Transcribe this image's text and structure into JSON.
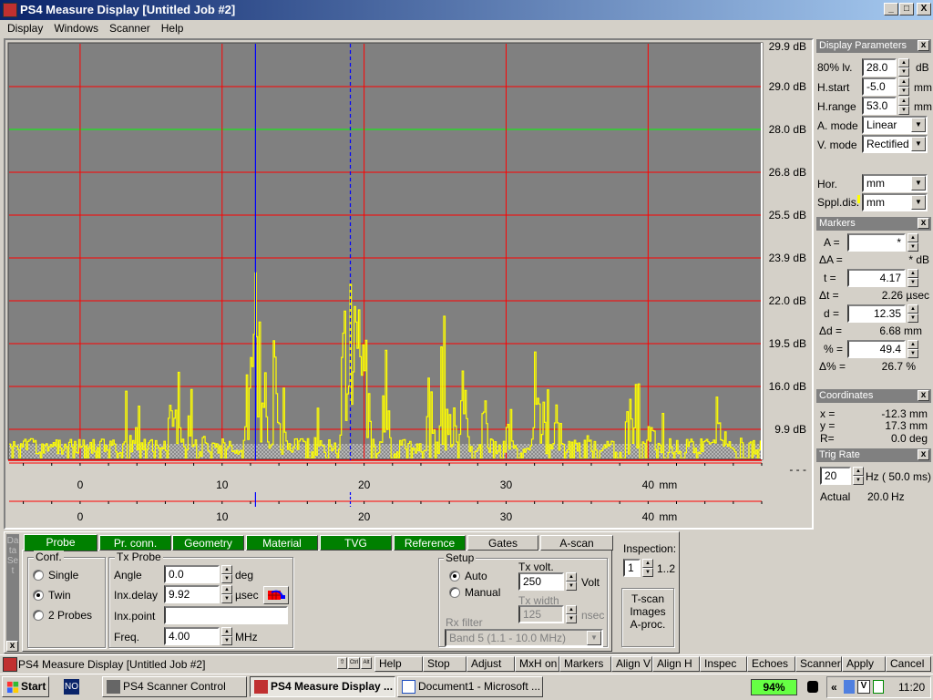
{
  "window": {
    "title": "PS4 Measure Display [Untitled Job #2]",
    "controls": [
      "_",
      "□",
      "X"
    ]
  },
  "menu": [
    "Display",
    "Windows",
    "Scanner",
    "Help"
  ],
  "chart_data": {
    "type": "line",
    "series_color": "#ffff00",
    "background": "#808080",
    "grid": true,
    "grid_color": "#ff0000",
    "ref_line": {
      "level_pct": 80,
      "color": "#00ff00"
    },
    "x_unit": "mm",
    "xlim": [
      -5,
      48
    ],
    "x_ticks": [
      0,
      10,
      20,
      30,
      40
    ],
    "ylim_pct": [
      0,
      100
    ],
    "y_tick_labels": [
      "29.9 dB",
      "29.0 dB",
      "28.0 dB",
      "26.8 dB",
      "25.5 dB",
      "23.9 dB",
      "22.0 dB",
      "19.5 dB",
      "16.0 dB",
      "9.9 dB",
      "- - -"
    ],
    "markers": {
      "solid_mm": 12.35,
      "dashed_mm": 19.03,
      "color": "#0000ff"
    },
    "noise_level_pct": 6,
    "peaks": [
      {
        "x": 3.3,
        "amp": 24
      },
      {
        "x": 4.0,
        "amp": 18
      },
      {
        "x": 6.3,
        "amp": 30
      },
      {
        "x": 6.8,
        "amp": 30
      },
      {
        "x": 7.8,
        "amp": 25
      },
      {
        "x": 8.5,
        "amp": 25
      },
      {
        "x": 11.9,
        "amp": 42
      },
      {
        "x": 12.4,
        "amp": 81
      },
      {
        "x": 12.8,
        "amp": 65
      },
      {
        "x": 13.6,
        "amp": 42
      },
      {
        "x": 14.2,
        "amp": 24
      },
      {
        "x": 16.0,
        "amp": 18
      },
      {
        "x": 16.6,
        "amp": 18
      },
      {
        "x": 18.6,
        "amp": 58
      },
      {
        "x": 19.2,
        "amp": 81
      },
      {
        "x": 19.7,
        "amp": 65
      },
      {
        "x": 20.1,
        "amp": 42
      },
      {
        "x": 21.5,
        "amp": 30
      },
      {
        "x": 24.6,
        "amp": 32
      },
      {
        "x": 25.6,
        "amp": 50
      },
      {
        "x": 26.2,
        "amp": 38
      },
      {
        "x": 27.0,
        "amp": 28
      },
      {
        "x": 28.4,
        "amp": 19
      },
      {
        "x": 30.2,
        "amp": 19
      },
      {
        "x": 32.1,
        "amp": 32
      },
      {
        "x": 32.8,
        "amp": 30
      },
      {
        "x": 33.6,
        "amp": 25
      },
      {
        "x": 35.6,
        "amp": 14
      },
      {
        "x": 38.6,
        "amp": 25
      },
      {
        "x": 39.2,
        "amp": 25
      },
      {
        "x": 40.2,
        "amp": 18
      },
      {
        "x": 41.0,
        "amp": 18
      },
      {
        "x": 44.8,
        "amp": 20
      },
      {
        "x": 45.6,
        "amp": 17
      },
      {
        "x": 46.5,
        "amp": 16
      }
    ]
  },
  "display_params": {
    "title": "Display Parameters",
    "close": "x",
    "level_label": "80% lv.",
    "level": "28.0",
    "level_unit": "dB",
    "hstart_label": "H.start",
    "hstart": "-5.0",
    "hstart_unit": "mm",
    "hrange_label": "H.range",
    "hrange": "53.0",
    "hrange_unit": "mm",
    "amode_label": "A. mode",
    "amode": "Linear",
    "vmode_label": "V. mode",
    "vmode": "Rectified",
    "hor_label": "Hor.",
    "hor": "mm",
    "sppl_label": "Sppl.dis.",
    "sppl": "mm"
  },
  "markers": {
    "title": "Markers",
    "close": "x",
    "a_label": "A  =",
    "a": "*",
    "da_label": "ΔA  =",
    "da": "* dB",
    "t_label": "t  =",
    "t": "4.17",
    "dt_label": "Δt  =",
    "dt": "2.26 µsec",
    "d_label": "d  =",
    "d": "12.35",
    "dd_label": "Δd  =",
    "dd": "6.68 mm",
    "p_label": "%  =",
    "p": "49.4",
    "dp_label": "Δ%  =",
    "dp": "26.7 %"
  },
  "coordinates": {
    "title": "Coordinates",
    "close": "x",
    "x_label": "x =",
    "x": "-12.3 mm",
    "y_label": "y =",
    "y": "17.3 mm",
    "r_label": "R=",
    "r": "0.0 deg"
  },
  "trig": {
    "title": "Trig Rate",
    "close": "x",
    "rate": "20",
    "unit": "Hz (",
    "period": "50.0 ms)",
    "actual_label": "Actual",
    "actual": "20.0",
    "actual_unit": "Hz"
  },
  "dataset": {
    "label": "Data Set",
    "close": "x"
  },
  "tabs": [
    {
      "label": "Probe",
      "green": true
    },
    {
      "label": "Pr. conn.",
      "green": true
    },
    {
      "label": "Geometry",
      "green": true
    },
    {
      "label": "Material",
      "green": true
    },
    {
      "label": "TVG",
      "green": true
    },
    {
      "label": "Reference",
      "green": true
    },
    {
      "label": "Gates",
      "green": false
    },
    {
      "label": "A-scan",
      "green": false
    }
  ],
  "probe": {
    "conf_title": "Conf.",
    "conf_options": [
      "Single",
      "Twin",
      "2 Probes"
    ],
    "conf_selected": "Twin",
    "tx_title": "Tx Probe",
    "angle_label": "Angle",
    "angle": "0.0",
    "angle_unit": "deg",
    "delay_label": "Inx.delay",
    "delay": "9.92",
    "delay_unit": "µsec",
    "point_label": "Inx.point",
    "point": "",
    "freq_label": "Freq.",
    "freq": "4.00",
    "freq_unit": "MHz",
    "setup_title": "Setup",
    "setup_options": [
      "Auto",
      "Manual"
    ],
    "setup_selected": "Auto",
    "txvolt_label": "Tx volt.",
    "txvolt": "250",
    "txvolt_unit": "Volt",
    "txwidth_label": "Tx width",
    "txwidth": "125",
    "txwidth_unit": "nsec",
    "rxfilter_label": "Rx filter",
    "rxfilter": "Band 5 (1.1 - 10.0 MHz)"
  },
  "inspection": {
    "label": "Inspection:",
    "value": "1",
    "range": "1..2",
    "tscan": [
      "T-scan",
      "Images",
      "A-proc."
    ]
  },
  "statusbar": {
    "title": "PS4 Measure Display [Untitled Job #2]",
    "keys": [
      "⇧",
      "Ctrl",
      "Alt"
    ],
    "buttons": [
      "Help",
      "Stop",
      "Adjust",
      "MxH on",
      "Markers",
      "Align V",
      "Align H",
      "Inspec",
      "Echoes",
      "Scanner",
      "Apply",
      "Cancel"
    ]
  },
  "taskbar": {
    "start": "Start",
    "lang": "NO",
    "tasks": [
      "PS4 Scanner Control",
      "PS4 Measure Display ...",
      "Document1 - Microsoft ..."
    ],
    "battery": "94%",
    "clock": "11:20"
  }
}
